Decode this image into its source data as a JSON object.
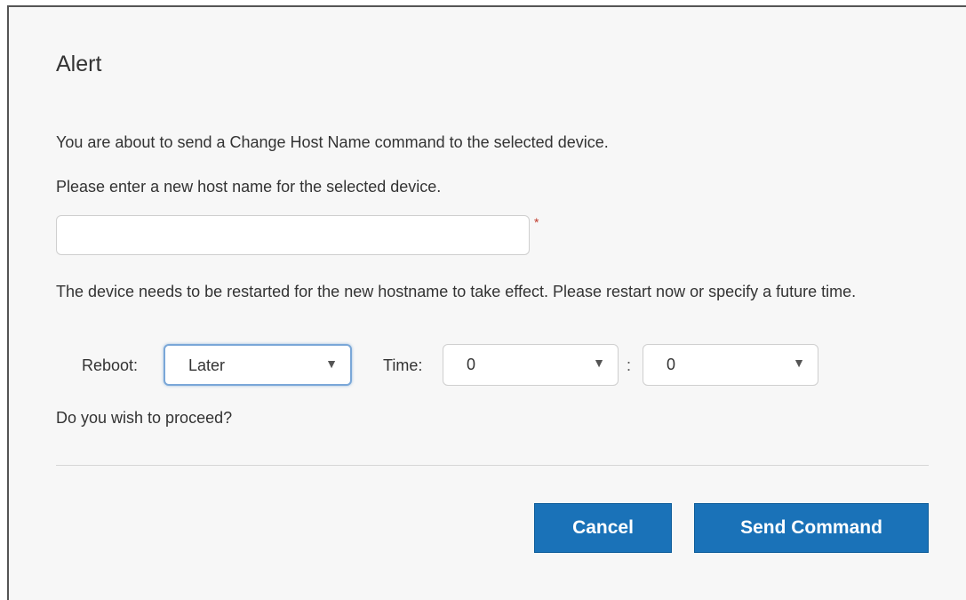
{
  "dialog": {
    "title": "Alert",
    "message1": "You are about to send a Change Host Name command to the selected device.",
    "message2": "Please enter a new host name for the selected device.",
    "host_input": {
      "value": "",
      "placeholder": "",
      "required_marker": "*"
    },
    "message3": "The device needs to be restarted for the new hostname to take effect. Please restart now or specify a future time.",
    "reboot": {
      "label": "Reboot:",
      "selected": "Later",
      "arrow": "▼"
    },
    "time": {
      "label": "Time:",
      "hour": {
        "selected": "0",
        "arrow": "▼"
      },
      "separator": ":",
      "minute": {
        "selected": "0",
        "arrow": "▼"
      }
    },
    "message4": "Do you wish to proceed?",
    "buttons": {
      "cancel": "Cancel",
      "send": "Send Command"
    },
    "accent_color": "#1a72b8"
  }
}
